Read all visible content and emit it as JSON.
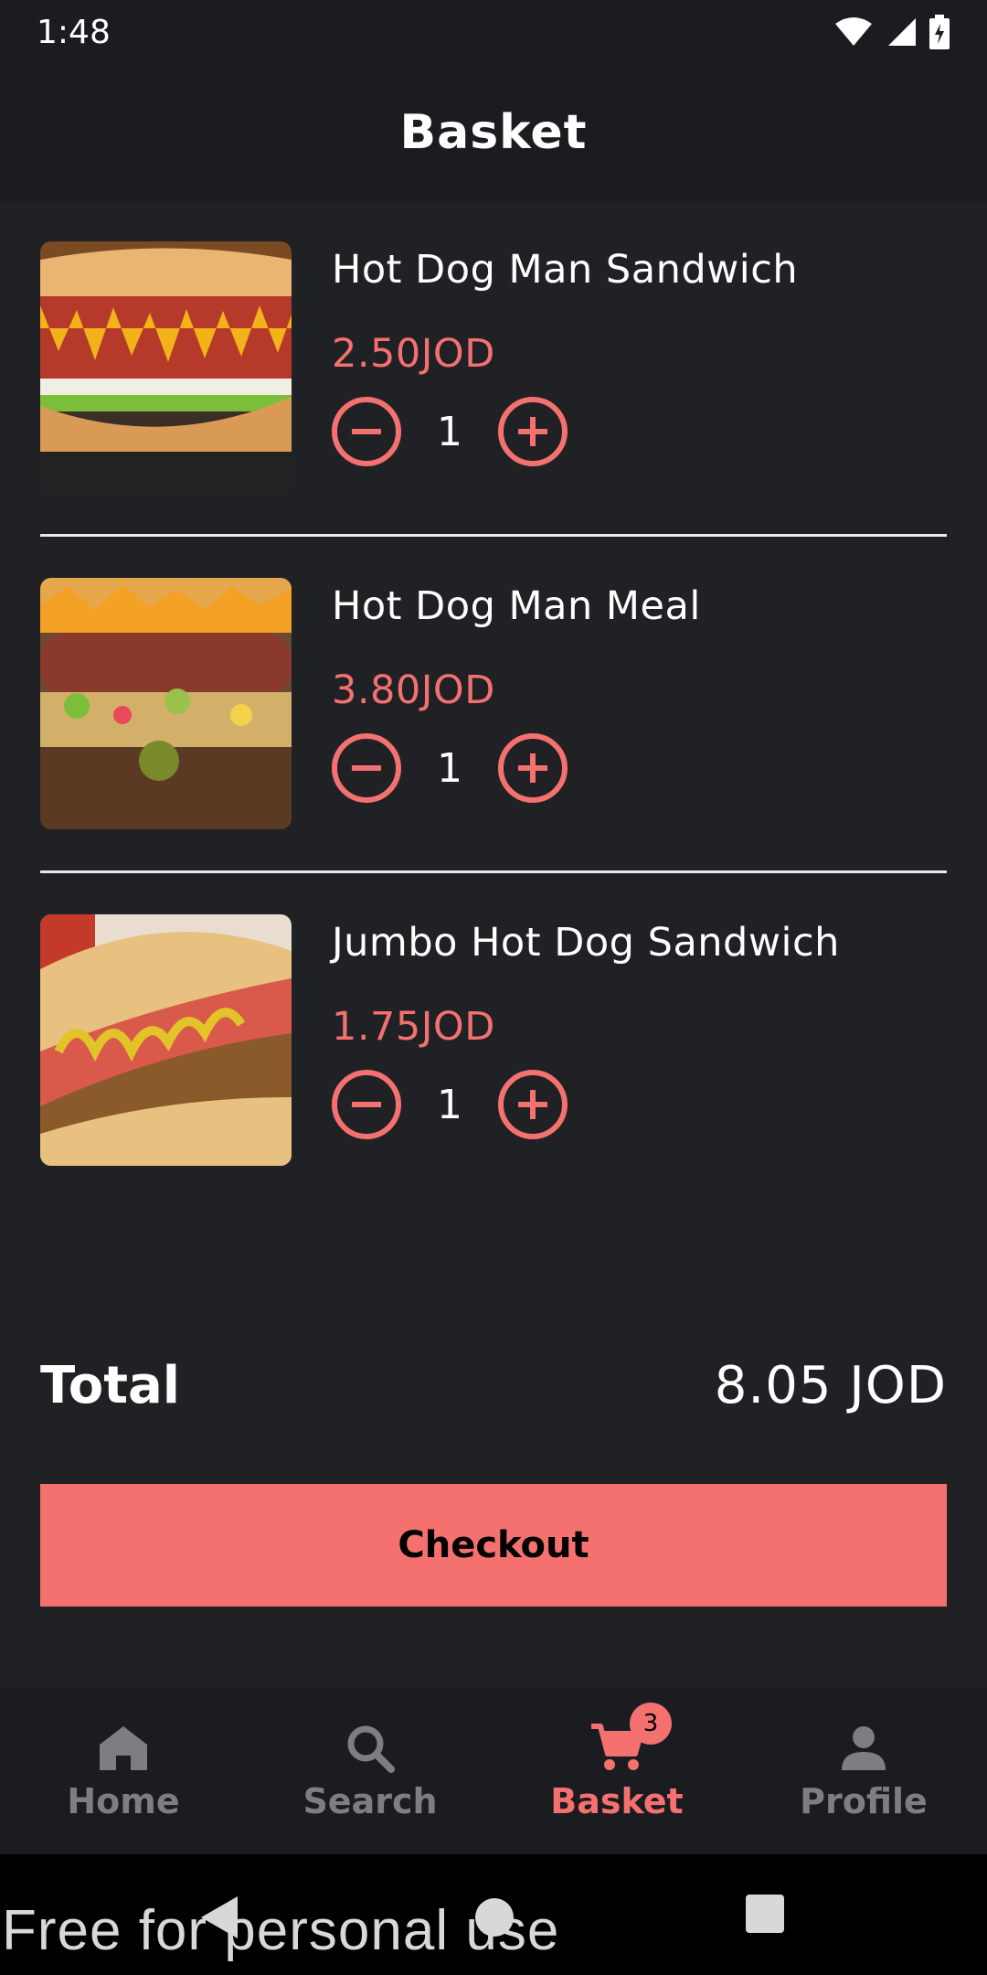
{
  "status_bar": {
    "time": "1:48"
  },
  "header": {
    "title": "Basket"
  },
  "items": [
    {
      "name": "Hot Dog Man Sandwich",
      "price": "2.50JOD",
      "quantity": "1"
    },
    {
      "name": "Hot Dog Man Meal",
      "price": "3.80JOD",
      "quantity": "1"
    },
    {
      "name": "Jumbo Hot Dog Sandwich",
      "price": "1.75JOD",
      "quantity": "1"
    }
  ],
  "total": {
    "label": "Total",
    "value": "8.05 JOD"
  },
  "checkout": {
    "label": "Checkout"
  },
  "bottom_nav": {
    "items": [
      {
        "label": "Home",
        "icon": "home-icon"
      },
      {
        "label": "Search",
        "icon": "search-icon"
      },
      {
        "label": "Basket",
        "icon": "cart-icon",
        "badge": "3",
        "active": true
      },
      {
        "label": "Profile",
        "icon": "person-icon"
      }
    ]
  },
  "watermark": "Free for personal use",
  "colors": {
    "accent": "#f47170",
    "background": "#202125",
    "bar": "#1b1c20",
    "inactive": "#7d7e82"
  }
}
